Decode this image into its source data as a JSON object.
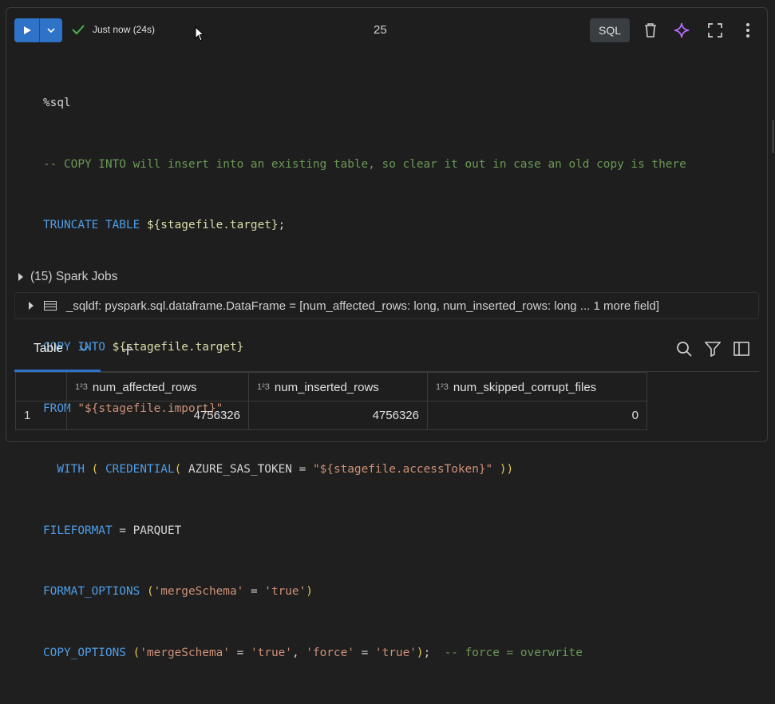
{
  "toolbar": {
    "status_text": "Just now (24s)",
    "cell_number": "25",
    "language": "SQL"
  },
  "code": {
    "magic": "%sql",
    "comment": "-- COPY INTO will insert into an existing table, so clear it out in case an old copy is there",
    "truncate_kw": "TRUNCATE TABLE",
    "truncate_var": "${stagefile.target}",
    "copy_kw": "COPY INTO",
    "copy_var": "${stagefile.target}",
    "from_kw": "FROM",
    "from_val": "\"${stagefile.import}\"",
    "with_kw": "WITH",
    "credential_kw": "CREDENTIAL",
    "token_key": "AZURE_SAS_TOKEN",
    "token_eq": " = ",
    "token_val": "\"${stagefile.accessToken}\"",
    "fileformat_kw": "FILEFORMAT",
    "fileformat_val": "PARQUET",
    "format_options_kw": "FORMAT_OPTIONS",
    "format_key": "'mergeSchema'",
    "format_val": "'true'",
    "copy_options_kw": "COPY_OPTIONS",
    "copy_key1": "'mergeSchema'",
    "copy_val1": "'true'",
    "copy_key2": "'force'",
    "copy_val2": "'true'",
    "copy_comment": "-- force = overwrite"
  },
  "spark_jobs": "(15) Spark Jobs",
  "dataframe": {
    "label": "_sqldf:  pyspark.sql.dataframe.DataFrame = [num_affected_rows: long, num_inserted_rows: long ... 1 more field]"
  },
  "results": {
    "tab_label": "Table",
    "columns": [
      "num_affected_rows",
      "num_inserted_rows",
      "num_skipped_corrupt_files"
    ],
    "type_label": "1²3",
    "rows": [
      {
        "index": "1",
        "values": [
          "4756326",
          "4756326",
          "0"
        ]
      }
    ]
  },
  "colors": {
    "run_button": "#2f73c9",
    "keyword": "#4f9de6",
    "comment": "#6a9955",
    "string": "#ce9178"
  }
}
